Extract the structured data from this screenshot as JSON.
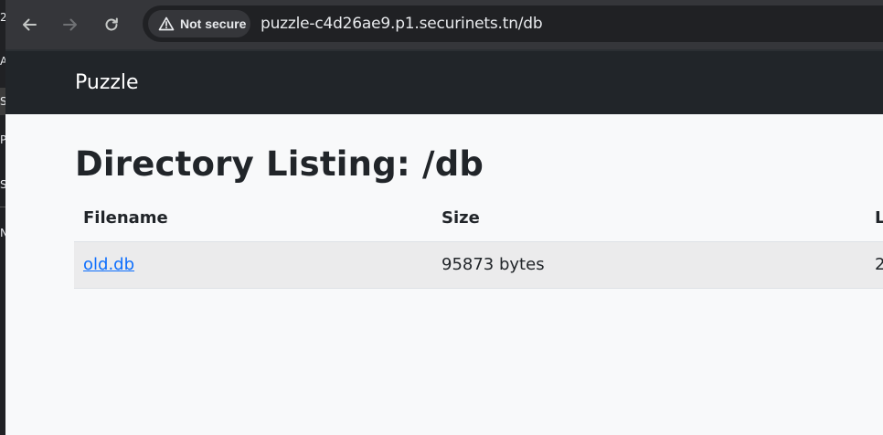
{
  "browser": {
    "security_label": "Not secure",
    "url": "puzzle-c4d26ae9.p1.securinets.tn/db"
  },
  "left_strip": [
    "2",
    "A",
    "S",
    "P",
    "S",
    "N"
  ],
  "navbar": {
    "brand": "Puzzle"
  },
  "main": {
    "title": "Directory Listing: /db",
    "table": {
      "headers": [
        "Filename",
        "Size",
        "L"
      ],
      "rows": [
        {
          "filename": "old.db",
          "size": "95873 bytes",
          "last": "2"
        }
      ]
    }
  },
  "colors": {
    "toolbar_bg": "#35363a",
    "omnibox_bg": "#202124",
    "navbar_bg": "#212529",
    "page_bg": "#f8f9fa",
    "link": "#0d6efd"
  }
}
